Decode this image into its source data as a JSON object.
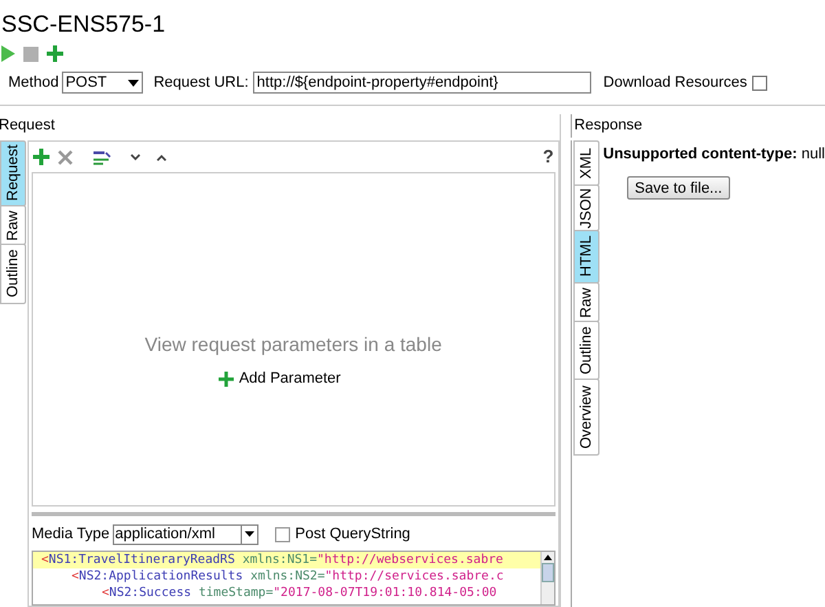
{
  "title": "SSC-ENS575-1",
  "method": {
    "label": "Method",
    "value": "POST"
  },
  "request_url": {
    "label": "Request URL:",
    "value": "http://${endpoint-property#endpoint}"
  },
  "download_resources": {
    "label": "Download Resources",
    "checked": false
  },
  "request": {
    "label": "Request",
    "tabs": [
      {
        "label": "Request",
        "selected": true
      },
      {
        "label": "Raw",
        "selected": false
      },
      {
        "label": "Outline",
        "selected": false
      }
    ],
    "help": "?",
    "empty_text": "View request parameters in a table",
    "add_parameter": "Add Parameter",
    "media_type": {
      "label": "Media Type",
      "value": "application/xml"
    },
    "post_querystring": {
      "label": "Post QueryString",
      "checked": false
    },
    "code_lines": [
      {
        "open": "<",
        "tag": "NS1:TravelItineraryReadRS",
        "attr": "xmlns:NS1=",
        "value": "\"http://webservices.sabre",
        "highlighted": true,
        "children": [
          {
            "open": "<",
            "tag": "NS2:ApplicationResults",
            "attr": "xmlns:NS2=",
            "value": "\"http://services.sabre.c",
            "highlighted": false,
            "children": [
              {
                "open": "<",
                "tag": "NS2:Success",
                "attr": "timeStamp=",
                "value": "\"2017-08-07T19:01:10.814-05:00",
                "highlighted": false
              }
            ]
          }
        ]
      }
    ]
  },
  "response": {
    "label": "Response",
    "tabs": [
      {
        "label": "XML",
        "selected": false
      },
      {
        "label": "JSON",
        "selected": false
      },
      {
        "label": "HTML",
        "selected": true
      },
      {
        "label": "Raw",
        "selected": false
      },
      {
        "label": "Outline",
        "selected": false
      },
      {
        "label": "Overview",
        "selected": false
      }
    ],
    "message_label": "Unsupported content-type:",
    "message_value": "null",
    "save_button": "Save to file..."
  }
}
